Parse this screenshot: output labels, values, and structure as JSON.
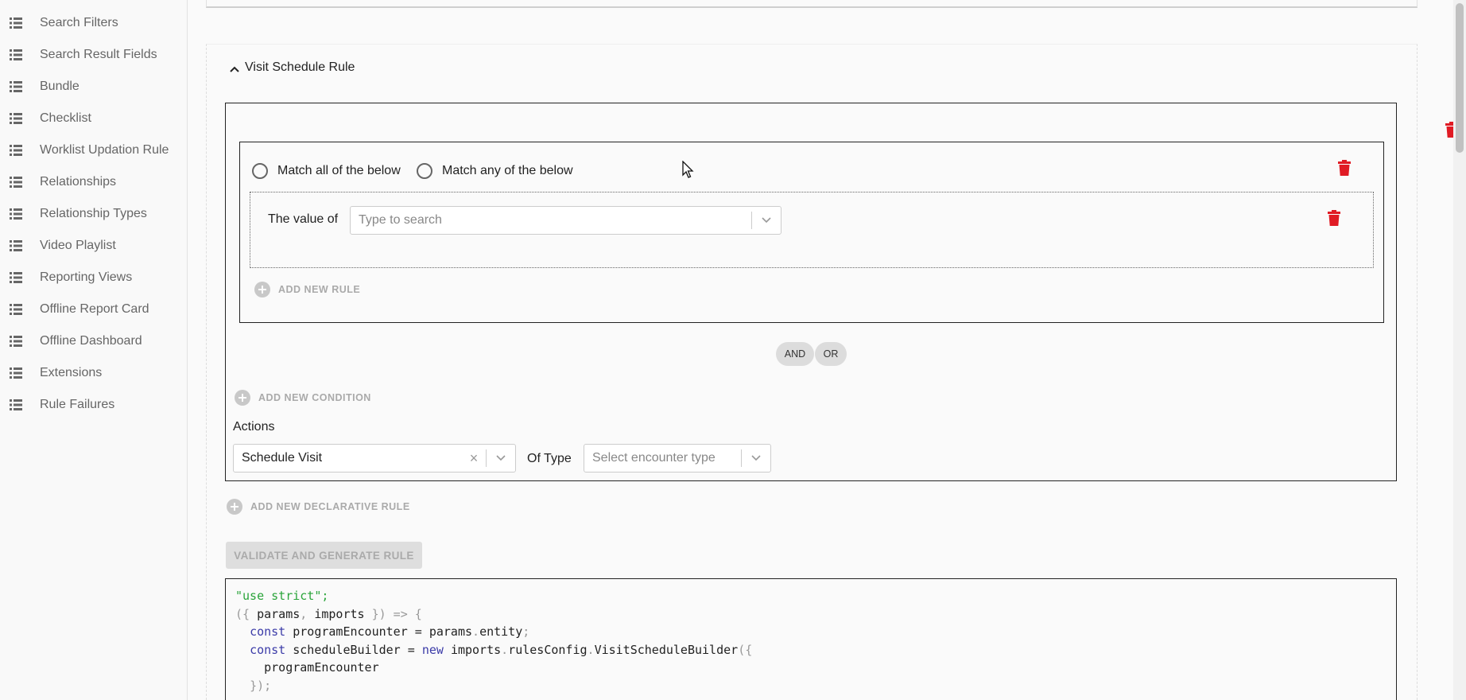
{
  "sidebar": {
    "items": [
      {
        "label": "Search Filters"
      },
      {
        "label": "Search Result Fields"
      },
      {
        "label": "Bundle"
      },
      {
        "label": "Checklist"
      },
      {
        "label": "Worklist Updation Rule"
      },
      {
        "label": "Relationships"
      },
      {
        "label": "Relationship Types"
      },
      {
        "label": "Video Playlist"
      },
      {
        "label": "Reporting Views"
      },
      {
        "label": "Offline Report Card"
      },
      {
        "label": "Offline Dashboard"
      },
      {
        "label": "Extensions"
      },
      {
        "label": "Rule Failures"
      }
    ],
    "item_icon": "list-icon"
  },
  "section": {
    "title": "Visit Schedule Rule"
  },
  "condition": {
    "match_all_label": "Match all of the below",
    "match_any_label": "Match any of the below",
    "value_of_label": "The value of",
    "search_placeholder": "Type to search",
    "add_rule_label": "ADD NEW RULE"
  },
  "conjunction": {
    "and_label": "AND",
    "or_label": "OR"
  },
  "add_condition_label": "ADD NEW CONDITION",
  "actions": {
    "label": "Actions",
    "selected_action": "Schedule Visit",
    "of_type_label": "Of Type",
    "encounter_placeholder": "Select encounter type"
  },
  "add_declarative_rule_label": "ADD NEW DECLARATIVE RULE",
  "validate_button_label": "VALIDATE AND GENERATE RULE",
  "code": {
    "line1": "\"use strict\";",
    "line2_open": "({",
    "line2_params": "params",
    "line2_comma": ",",
    "line2_imports": "imports",
    "line2_close": "}) =>",
    "line2_brace": "{",
    "line3_kw": "const",
    "line3_name": "programEncounter",
    "line3_eq": "=",
    "line3_obj": "params",
    "line3_dot": ".",
    "line3_prop": "entity",
    "line3_semi": ";",
    "line4_kw": "const",
    "line4_name": "scheduleBuilder",
    "line4_eq": "=",
    "line4_new": "new",
    "line4_obj": "imports",
    "line4_dot1": ".",
    "line4_p1": "rulesConfig",
    "line4_dot2": ".",
    "line4_p2": "VisitScheduleBuilder",
    "line4_open": "({",
    "line5": "programEncounter",
    "line6": "});"
  },
  "colors": {
    "trash": "#e01b24",
    "add_link": "#aaaaaa",
    "string": "#2aa43a",
    "keyword": "#3b3ba8"
  }
}
